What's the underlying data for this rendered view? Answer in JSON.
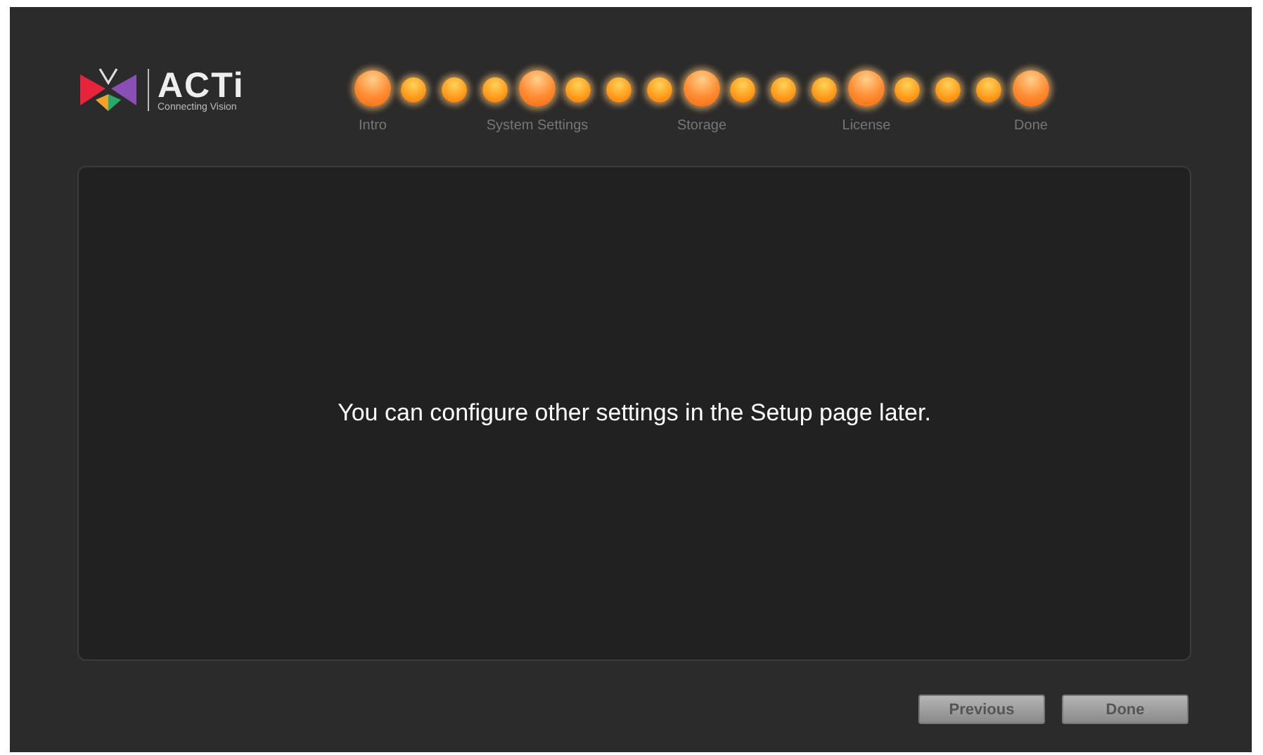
{
  "logo": {
    "name": "ACTi",
    "tagline": "Connecting Vision"
  },
  "steps": [
    {
      "kind": "major",
      "label": "Intro"
    },
    {
      "kind": "minor"
    },
    {
      "kind": "minor"
    },
    {
      "kind": "minor"
    },
    {
      "kind": "major",
      "label": "System Settings"
    },
    {
      "kind": "minor"
    },
    {
      "kind": "minor"
    },
    {
      "kind": "minor"
    },
    {
      "kind": "major",
      "label": "Storage"
    },
    {
      "kind": "minor"
    },
    {
      "kind": "minor"
    },
    {
      "kind": "minor"
    },
    {
      "kind": "major",
      "label": "License"
    },
    {
      "kind": "minor"
    },
    {
      "kind": "minor"
    },
    {
      "kind": "minor"
    },
    {
      "kind": "major",
      "label": "Done"
    }
  ],
  "message": "You can configure other settings in the Setup page later.",
  "buttons": [
    "Previous",
    "Done"
  ]
}
